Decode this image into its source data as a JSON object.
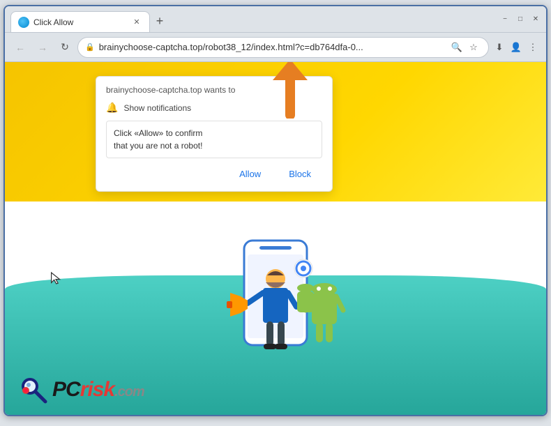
{
  "browser": {
    "tab_title": "Click Allow",
    "url": "brainychoose-captcha.top/robot38_12/index.html?c=db764dfa-0...",
    "new_tab_tooltip": "+",
    "minimize_label": "−",
    "maximize_label": "□",
    "close_label": "✕"
  },
  "toolbar": {
    "back_btn": "←",
    "forward_btn": "→",
    "refresh_btn": "↻",
    "lock_icon": "🔒"
  },
  "notification": {
    "header": "brainychoose-captcha.top wants to",
    "show_label": "Show notifications",
    "message": "Click «Allow» to confirm\nthat you are not a robot!",
    "allow_btn": "Allow",
    "block_btn": "Block"
  },
  "pcrisk": {
    "text_pc": "PC",
    "text_risk": "risk",
    "text_com": ".com"
  },
  "colors": {
    "yellow": "#ffd700",
    "teal": "#4dd0c4",
    "orange_arrow": "#e67e22",
    "blue_border": "#4a6fa5"
  }
}
